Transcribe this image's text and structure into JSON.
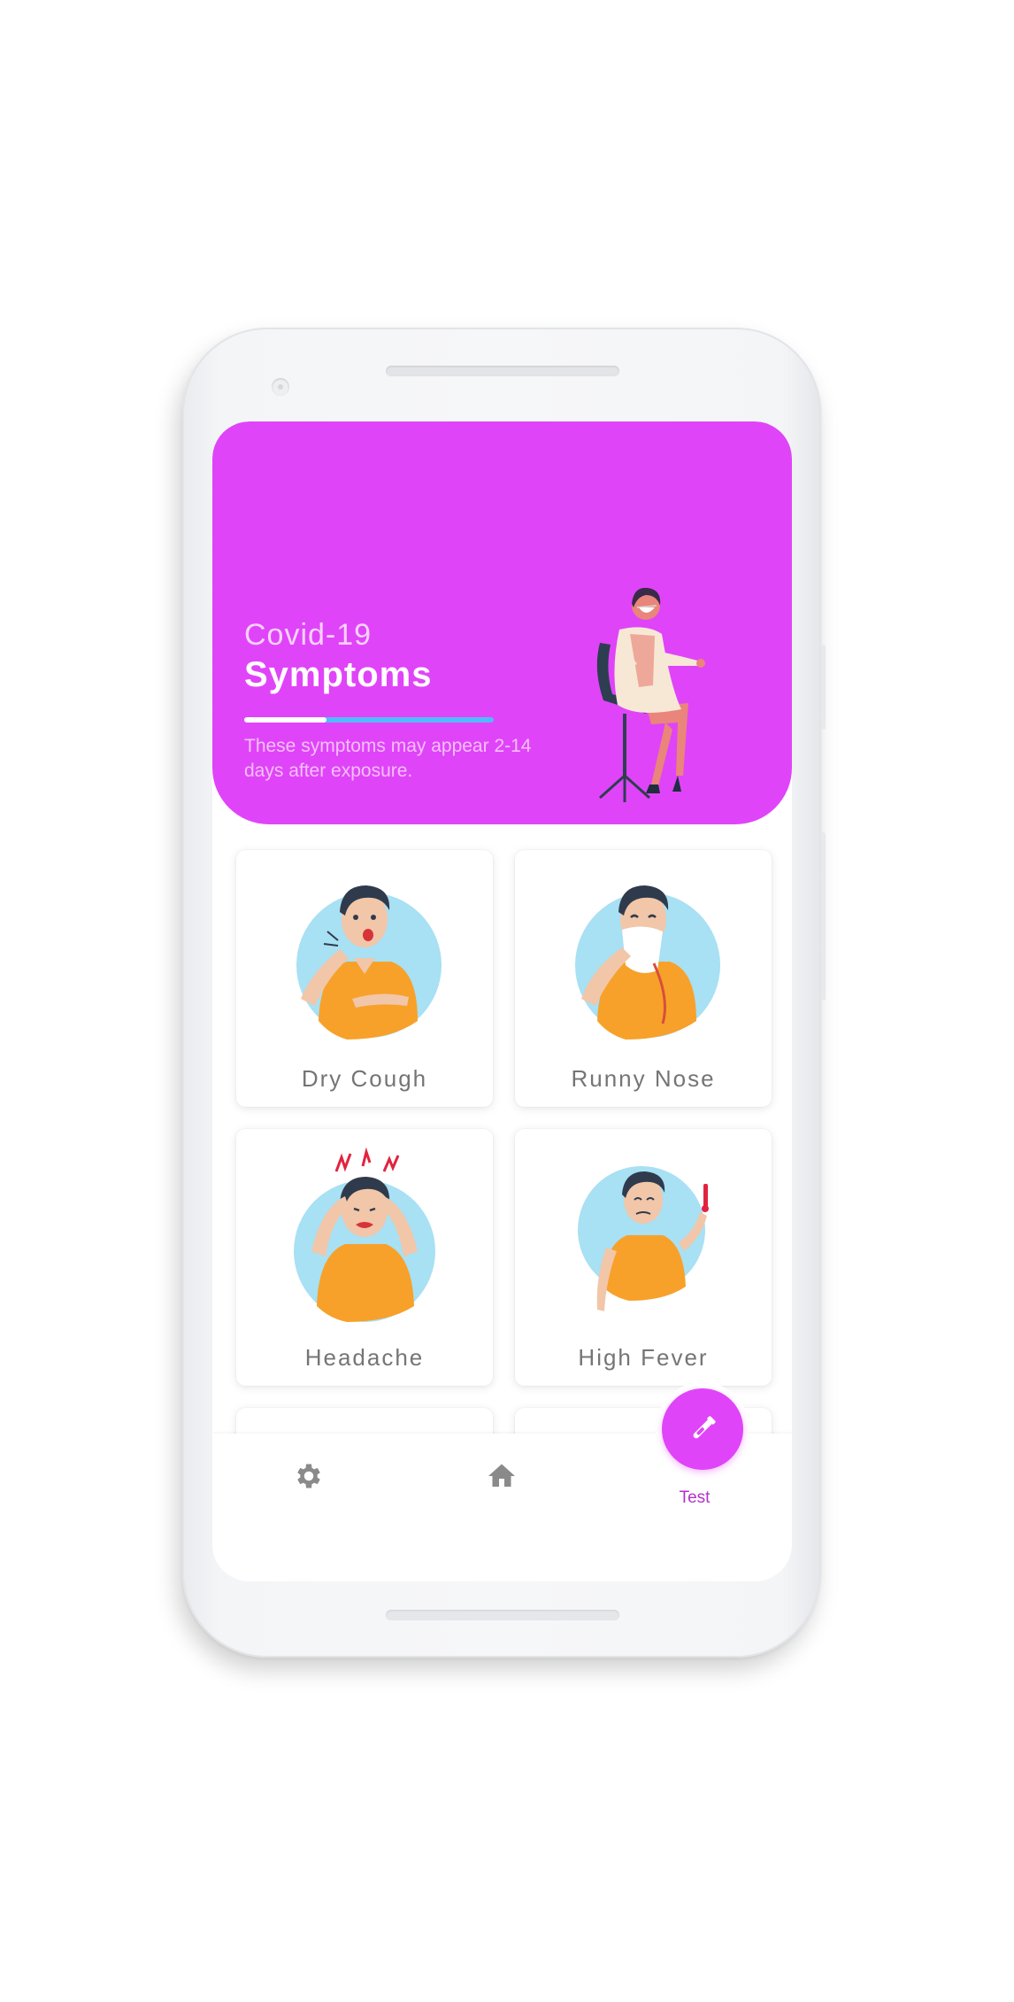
{
  "hero": {
    "subtitle": "Covid-19",
    "title": "Symptoms",
    "progress_fraction": 0.33,
    "description": "These symptoms may appear 2-14 days after exposure."
  },
  "symptoms": [
    {
      "label": "Dry Cough"
    },
    {
      "label": "Runny Nose"
    },
    {
      "label": "Headache"
    },
    {
      "label": "High Fever"
    }
  ],
  "nav": {
    "settings_icon": "gear-icon",
    "home_icon": "home-icon",
    "test_icon": "test-tube-icon",
    "test_label": "Test"
  },
  "colors": {
    "accent": "#e044f8",
    "progress_track": "#53b9ff",
    "card_label": "#757575",
    "nav_icon": "#8a8a8a",
    "illustration_circle": "#a8e0f4",
    "shirt": "#f7a12a"
  }
}
